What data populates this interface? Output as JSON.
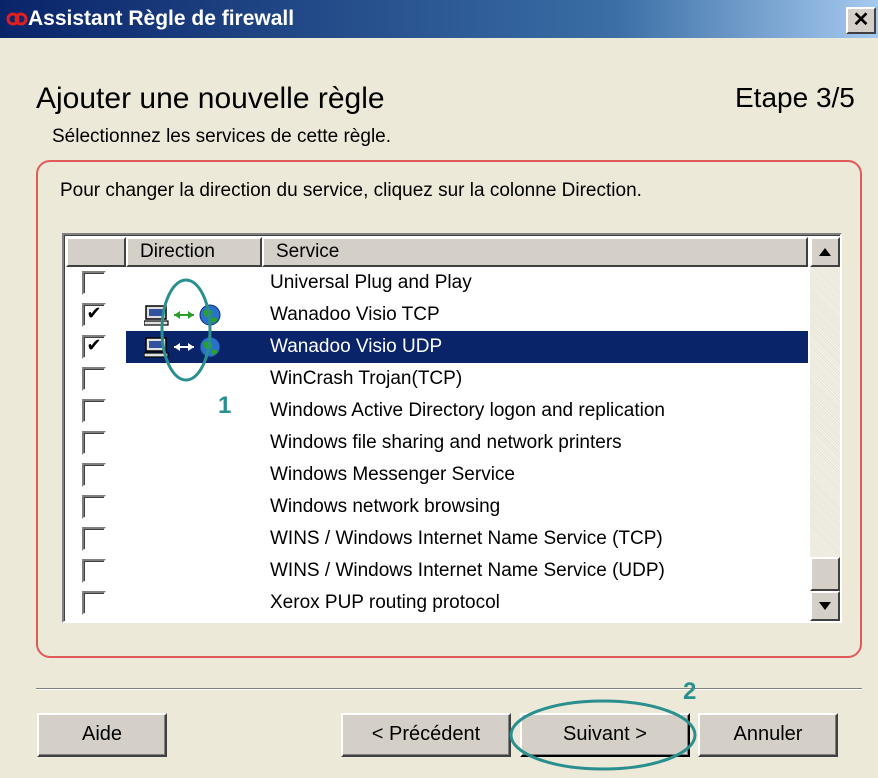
{
  "window": {
    "title": "Assistant Règle de firewall",
    "close_glyph": "✕"
  },
  "header": {
    "title": "Ajouter une nouvelle règle",
    "step": "Etape 3/5",
    "subtitle": "Sélectionnez les services de cette règle."
  },
  "instruction": "Pour changer la direction du service, cliquez sur la colonne Direction.",
  "list": {
    "columns": [
      "",
      "Direction",
      "Service"
    ],
    "rows": [
      {
        "label": "Universal Plug and Play",
        "checked": false,
        "direction": "",
        "selected": false
      },
      {
        "label": "Wanadoo Visio TCP",
        "checked": true,
        "direction": "both",
        "selected": false
      },
      {
        "label": "Wanadoo Visio UDP",
        "checked": true,
        "direction": "both",
        "selected": true
      },
      {
        "label": "WinCrash Trojan(TCP)",
        "checked": false,
        "direction": "",
        "selected": false
      },
      {
        "label": "Windows Active Directory logon and replication",
        "checked": false,
        "direction": "",
        "selected": false
      },
      {
        "label": "Windows file sharing and network printers",
        "checked": false,
        "direction": "",
        "selected": false
      },
      {
        "label": "Windows Messenger Service",
        "checked": false,
        "direction": "",
        "selected": false
      },
      {
        "label": "Windows network browsing",
        "checked": false,
        "direction": "",
        "selected": false
      },
      {
        "label": "WINS / Windows Internet Name Service (TCP)",
        "checked": false,
        "direction": "",
        "selected": false
      },
      {
        "label": "WINS / Windows Internet Name Service (UDP)",
        "checked": false,
        "direction": "",
        "selected": false
      },
      {
        "label": "Xerox PUP routing protocol",
        "checked": false,
        "direction": "",
        "selected": false
      }
    ],
    "scroll_up_glyph": "▲",
    "scroll_down_glyph": "▼"
  },
  "buttons": {
    "help": "Aide",
    "previous": "< Précédent",
    "next": "Suivant >",
    "cancel": "Annuler"
  },
  "annotations": {
    "marker_1": "1",
    "marker_2": "2",
    "color": "#2a8f8f"
  },
  "colors": {
    "titlebar": "#0a246a",
    "selection": "#0a246a",
    "frame": "#e05a5a",
    "dialog_bg": "#ece9d8"
  },
  "icons": {
    "computer": "computer-icon",
    "globe": "globe-icon",
    "arrow_both": "bidirectional-arrow-icon"
  }
}
